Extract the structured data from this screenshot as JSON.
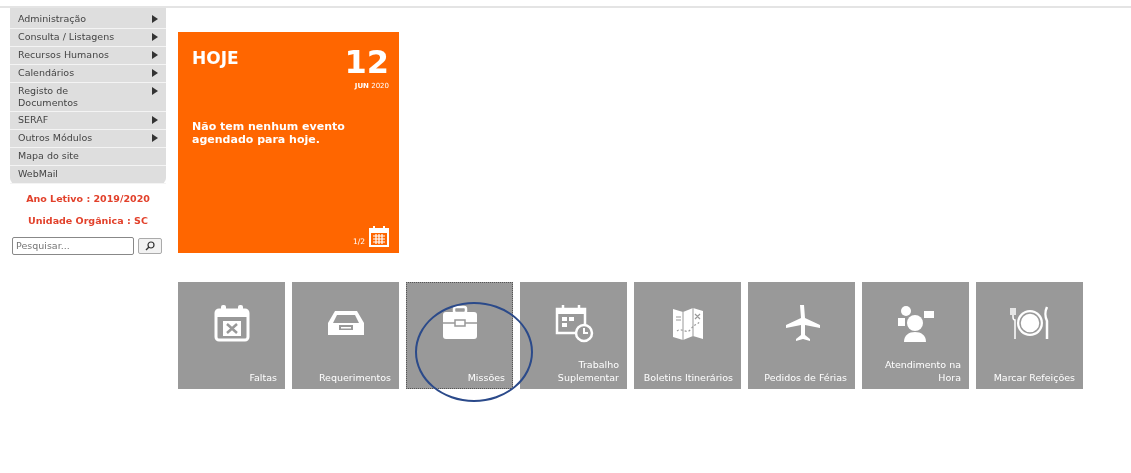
{
  "menu": [
    {
      "label": "Administração",
      "has_submenu": true
    },
    {
      "label": "Consulta / Listagens",
      "has_submenu": true
    },
    {
      "label": "Recursos Humanos",
      "has_submenu": true
    },
    {
      "label": "Calendários",
      "has_submenu": true
    },
    {
      "label": "Registo de Documentos",
      "has_submenu": true
    },
    {
      "label": "SERAF",
      "has_submenu": true
    },
    {
      "label": "Outros Módulos",
      "has_submenu": true
    },
    {
      "label": "Mapa do site",
      "has_submenu": false
    },
    {
      "label": "WebMail",
      "has_submenu": false
    }
  ],
  "school_year": "Ano Letivo : 2019/2020",
  "unit": "Unidade Orgânica : SC",
  "search": {
    "placeholder": "Pesquisar..."
  },
  "today_card": {
    "title": "HOJE",
    "day": "12",
    "month": "JUN",
    "year": "2020",
    "message": "Não tem nenhum evento agendado para hoje.",
    "pager": "1/2"
  },
  "tiles": [
    {
      "label": "Faltas",
      "focused": false
    },
    {
      "label": "Requerimentos",
      "focused": false
    },
    {
      "label": "Missões",
      "focused": true
    },
    {
      "label": "Trabalho Suplementar",
      "focused": false
    },
    {
      "label": "Boletins Itinerários",
      "focused": false
    },
    {
      "label": "Pedidos de Férias",
      "focused": false
    },
    {
      "label": "Atendimento na Hora",
      "focused": false
    },
    {
      "label": "Marcar Refeições",
      "focused": false
    }
  ],
  "annotation": {
    "kind": "circle"
  }
}
